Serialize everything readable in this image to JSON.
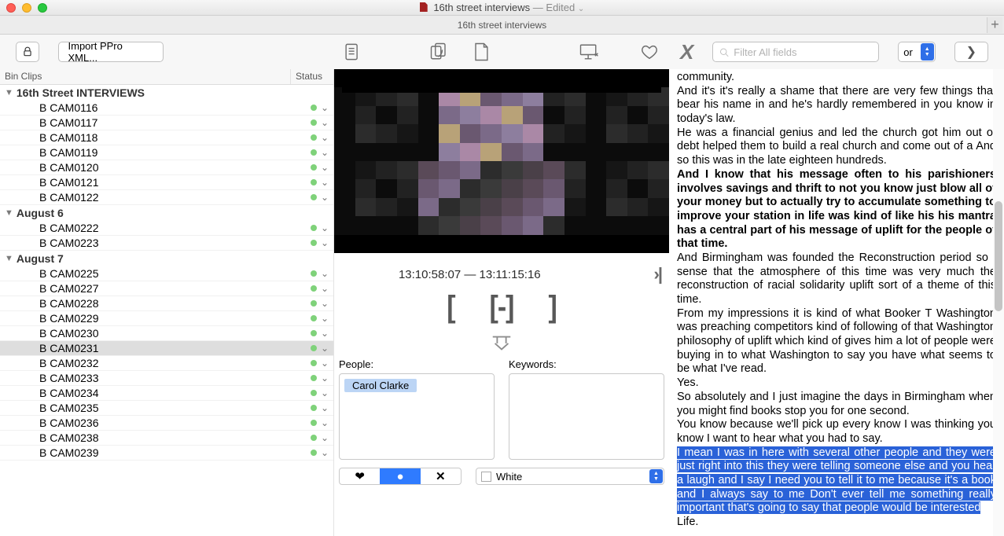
{
  "title": {
    "name": "16th street interviews",
    "edited": " — Edited",
    "chev": "⌄"
  },
  "docbar": {
    "name": "16th street interviews",
    "plus": "+"
  },
  "toolbar": {
    "import_label": "Import PPro XML...",
    "search_placeholder": "Filter All fields",
    "or_label": "or"
  },
  "bin": {
    "header": {
      "col1": "Bin Clips",
      "col2": "Status"
    },
    "groups": [
      {
        "label": "16th Street INTERVIEWS",
        "clips": [
          "B CAM0116",
          "B CAM0117",
          "B CAM0118",
          "B CAM0119",
          "B CAM0120",
          "B CAM0121",
          "B CAM0122"
        ]
      },
      {
        "label": "August 6",
        "clips": [
          "B CAM0222",
          "B CAM0223"
        ]
      },
      {
        "label": "August 7",
        "clips": [
          "B CAM0225",
          "B CAM0227",
          "B CAM0228",
          "B CAM0229",
          "B CAM0230",
          "B CAM0231",
          "B CAM0232",
          "B CAM0233",
          "B CAM0234",
          "B CAM0235",
          "B CAM0236",
          "B CAM0238",
          "B CAM0239"
        ]
      }
    ],
    "selected": "B CAM0231"
  },
  "viewer": {
    "timecode": "13:10:58:07 — 13:11:15:16",
    "skip": "›|",
    "brackets": [
      "[",
      "[-]",
      "]"
    ]
  },
  "meta": {
    "people_label": "People:",
    "keywords_label": "Keywords:",
    "person": "Carol Clarke",
    "color_label": "White"
  },
  "seg": {
    "circle": "●",
    "x": "✕"
  },
  "transcript": [
    {
      "t": "community.",
      "b": false
    },
    {
      "t": "And it's it's really a shame that there are very few things that bear his name in and he's hardly remembered in you know in today's law.",
      "b": false
    },
    {
      "t": "He was a financial genius and led the church got him out of debt helped them to build a real church and come out of a And so this was in the late eighteen hundreds.",
      "b": false
    },
    {
      "t": "And I know that his message often to his parishioners involves savings and thrift to not you know just blow all of your money but to actually try to accumulate something to improve your station in life was kind of like his his mantra has a central part of his message of uplift for the people of that time.",
      "b": true
    },
    {
      "t": "And Birmingham was founded the Reconstruction period so I sense that the atmosphere of this time was very much the reconstruction of racial solidarity uplift sort of a theme of this time.",
      "b": false
    },
    {
      "t": "From my impressions it is kind of what Booker T Washington was preaching competitors kind of following of that Washington philosophy of uplift which kind of gives him a lot of people were buying in to what Washington to say you have what seems to be what I've read.",
      "b": false
    },
    {
      "t": "Yes.",
      "b": false
    },
    {
      "t": "So absolutely and I just imagine the days in Birmingham when you might find books stop you for one second.",
      "b": false
    },
    {
      "t": "You know because we'll pick up every know I was thinking you know I want to hear what you had to say.",
      "b": false
    },
    {
      "t": "I mean I was in here with several other people and they were just right into this they were telling someone else and you hear a laugh and I say I need you to tell it to me because it's a book and I always say to me Don't ever tell me something really important that's going to say that people would be interested",
      "b": false,
      "hl": true
    },
    {
      "t": "Life.",
      "b": false
    }
  ]
}
